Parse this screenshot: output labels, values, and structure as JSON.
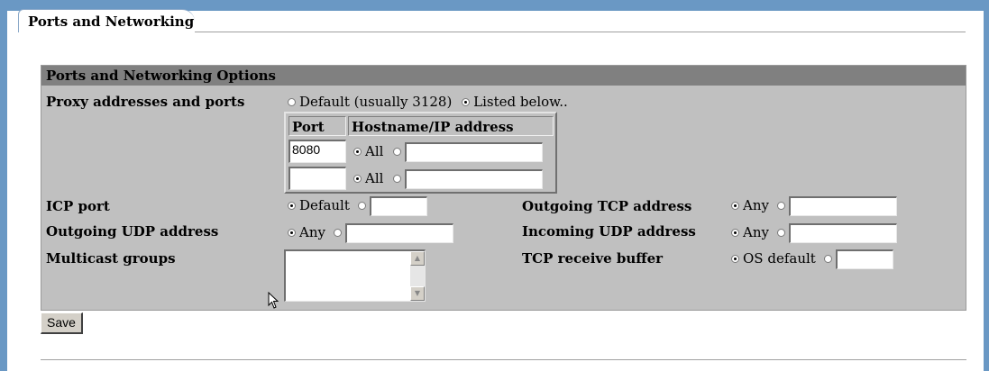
{
  "tab": {
    "label": "Ports and Networking"
  },
  "panel": {
    "title": "Ports and Networking Options",
    "proxy": {
      "label": "Proxy addresses and ports",
      "option_default": "Default (usually 3128)",
      "option_listed": "Listed below..",
      "selected": "listed",
      "table": {
        "col_port": "Port",
        "col_host": "Hostname/IP address",
        "rows": [
          {
            "port": "8080",
            "all_label": "All",
            "all_selected": true,
            "host": ""
          },
          {
            "port": "",
            "all_label": "All",
            "all_selected": true,
            "host": ""
          }
        ]
      }
    },
    "icp": {
      "label": "ICP port",
      "default_label": "Default",
      "selected": "default",
      "value": ""
    },
    "out_tcp": {
      "label": "Outgoing TCP address",
      "any_label": "Any",
      "selected": "any",
      "value": ""
    },
    "out_udp": {
      "label": "Outgoing UDP address",
      "any_label": "Any",
      "selected": "any",
      "value": ""
    },
    "in_udp": {
      "label": "Incoming UDP address",
      "any_label": "Any",
      "selected": "any",
      "value": ""
    },
    "multicast": {
      "label": "Multicast groups",
      "value": ""
    },
    "tcp_buf": {
      "label": "TCP receive buffer",
      "os_label": "OS default",
      "selected": "os",
      "value": ""
    }
  },
  "save_label": "Save"
}
